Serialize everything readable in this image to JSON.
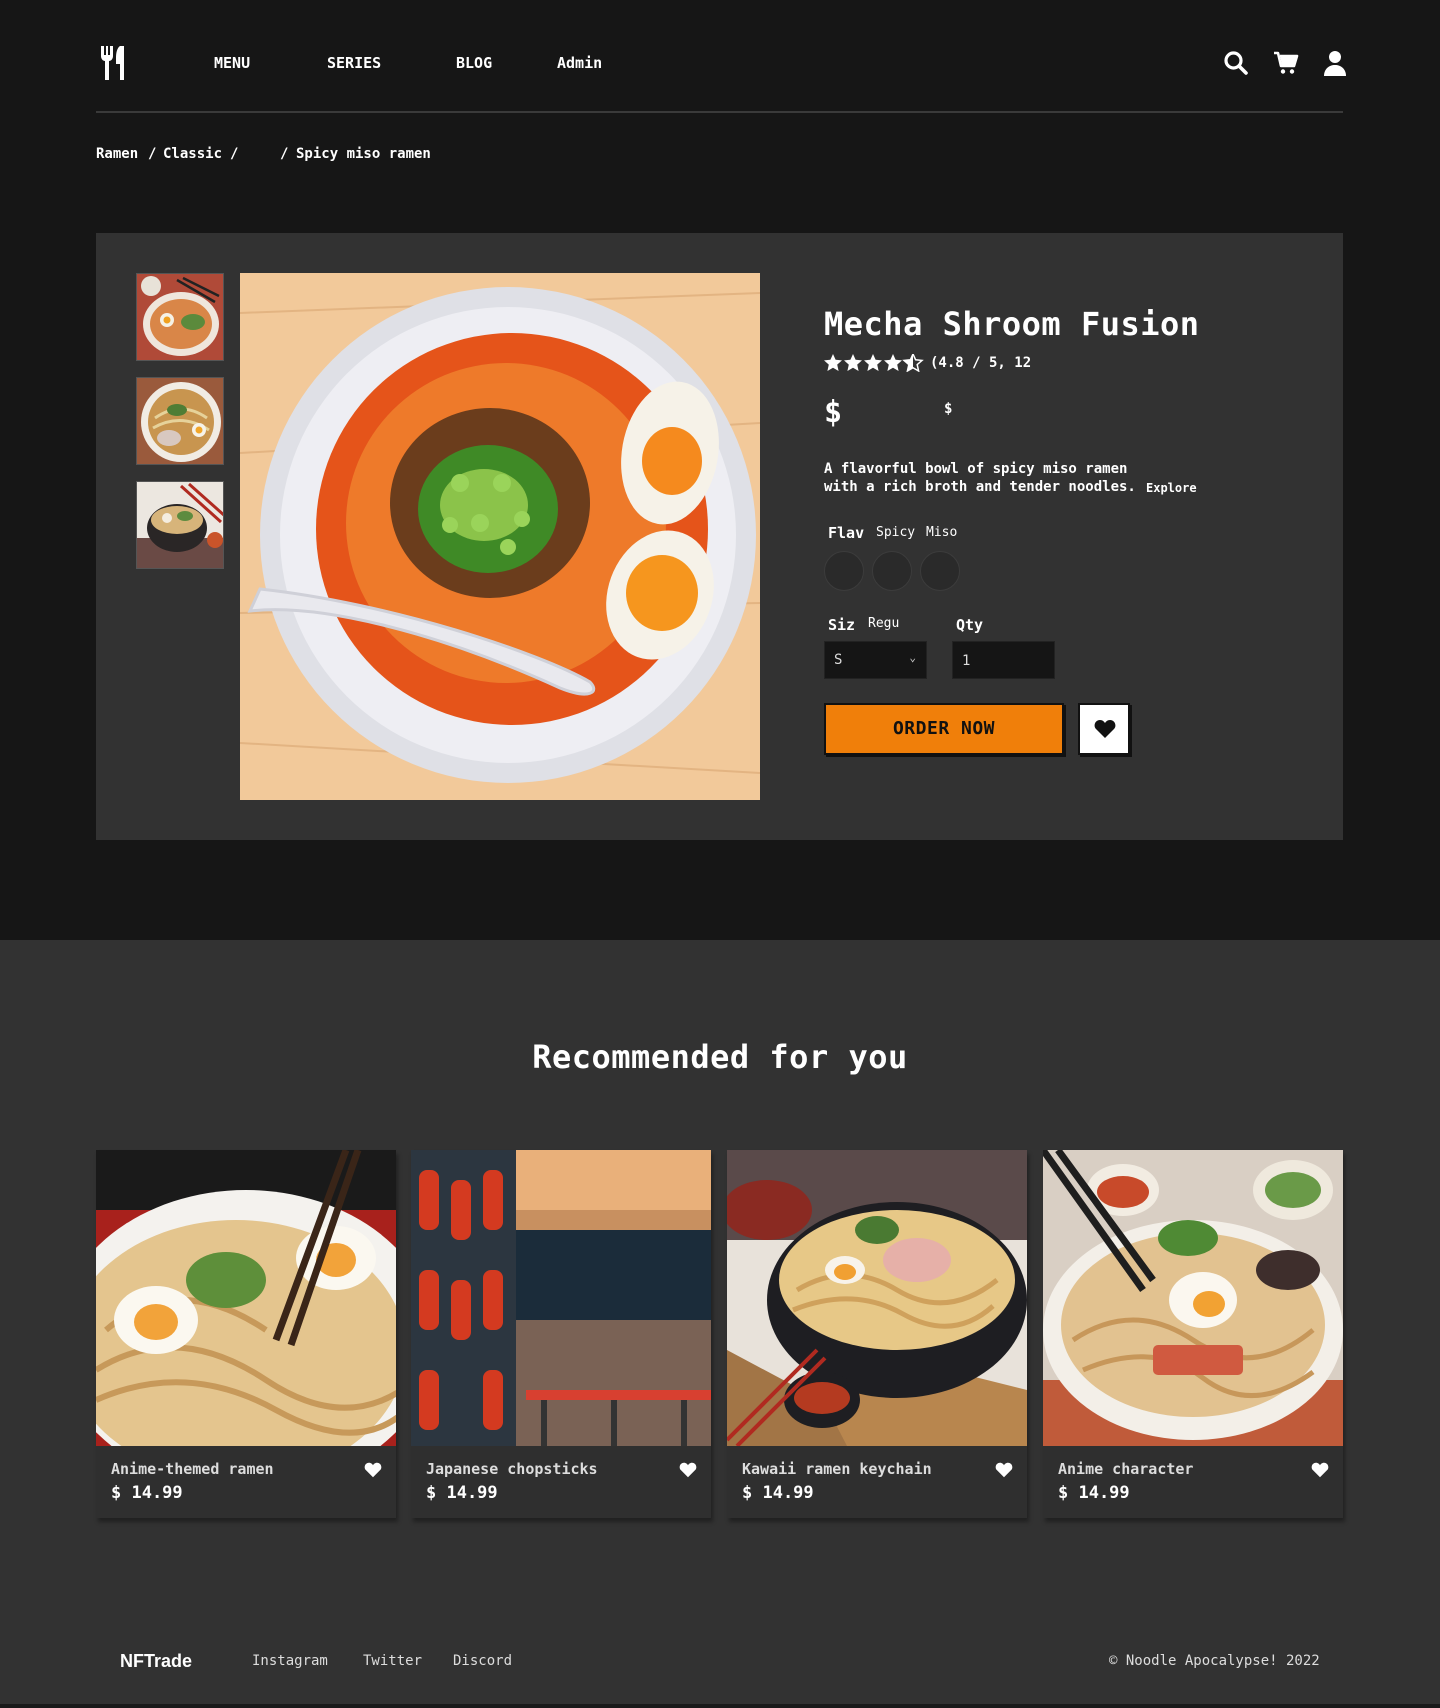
{
  "nav": {
    "items": [
      "MENU",
      "SERIES",
      "BLOG",
      "Admin"
    ],
    "icons": [
      "search-icon",
      "cart-icon",
      "user-icon"
    ]
  },
  "breadcrumb": {
    "part1": "Ramen",
    "sep1": "/",
    "part2": "Classic",
    "sep2": "/",
    "sep3": "/",
    "current": "Spicy miso ramen"
  },
  "product": {
    "title": "Mecha Shroom Fusion",
    "rating": 4.5,
    "rating_text": "(4.8 / 5, 12",
    "price_main": "$",
    "price_small": "$",
    "description": "A flavorful bowl of spicy miso ramen with a rich broth and tender noodles.",
    "explore": "Explore",
    "flavor_label": "Flav",
    "flavor_values": [
      "Spicy",
      "Miso"
    ],
    "size_label": "Siz",
    "size_value": "Regu",
    "qty_label": "Qty",
    "size_select": "S",
    "qty_value": "1",
    "order_label": "ORDER NOW"
  },
  "recommended": {
    "title": "Recommended for you",
    "items": [
      {
        "name": "Anime-themed ramen",
        "price": "$ 14.99"
      },
      {
        "name": "Japanese chopsticks",
        "price": "$ 14.99"
      },
      {
        "name": "Kawaii ramen keychain",
        "price": "$ 14.99"
      },
      {
        "name": "Anime character",
        "price": "$ 14.99"
      }
    ]
  },
  "footer": {
    "brand": "NFTrade",
    "links": [
      "Instagram",
      "Twitter",
      "Discord"
    ],
    "copyright": "© Noodle Apocalypse! 2022"
  },
  "colors": {
    "accent": "#f07f0a",
    "bg": "#161616",
    "panel": "#323232"
  }
}
